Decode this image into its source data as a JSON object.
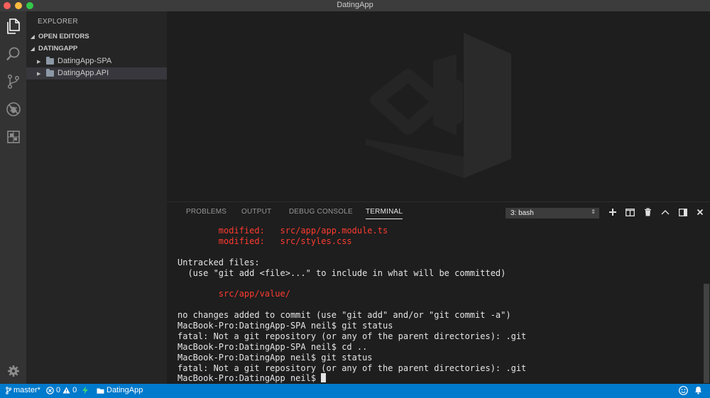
{
  "window": {
    "title": "DatingApp"
  },
  "sidebar": {
    "title": "EXPLORER",
    "sections": [
      {
        "label": "OPEN EDITORS"
      },
      {
        "label": "DATINGAPP"
      }
    ],
    "items": [
      {
        "label": "DatingApp-SPA"
      },
      {
        "label": "DatingApp.API"
      }
    ]
  },
  "panel": {
    "tabs": [
      {
        "label": "PROBLEMS"
      },
      {
        "label": "OUTPUT"
      },
      {
        "label": "DEBUG CONSOLE"
      },
      {
        "label": "TERMINAL"
      }
    ],
    "active_tab": "TERMINAL",
    "terminal_select": "3: bash"
  },
  "terminal": {
    "lines": [
      {
        "text": "        modified:   src/app/app.module.ts",
        "color": "red"
      },
      {
        "text": "        modified:   src/styles.css",
        "color": "red"
      },
      {
        "text": "",
        "color": "default"
      },
      {
        "text": "Untracked files:",
        "color": "default"
      },
      {
        "text": "  (use \"git add <file>...\" to include in what will be committed)",
        "color": "default"
      },
      {
        "text": "",
        "color": "default"
      },
      {
        "text": "        src/app/value/",
        "color": "red"
      },
      {
        "text": "",
        "color": "default"
      },
      {
        "text": "no changes added to commit (use \"git add\" and/or \"git commit -a\")",
        "color": "default"
      },
      {
        "text": "MacBook-Pro:DatingApp-SPA neil$ git status",
        "color": "default"
      },
      {
        "text": "fatal: Not a git repository (or any of the parent directories): .git",
        "color": "default"
      },
      {
        "text": "MacBook-Pro:DatingApp-SPA neil$ cd ..",
        "color": "default"
      },
      {
        "text": "MacBook-Pro:DatingApp neil$ git status",
        "color": "default"
      },
      {
        "text": "fatal: Not a git repository (or any of the parent directories): .git",
        "color": "default"
      }
    ],
    "prompt": "MacBook-Pro:DatingApp neil$ "
  },
  "statusbar": {
    "branch": "master*",
    "errors": "0",
    "warnings": "0",
    "folder": "DatingApp"
  },
  "colors": {
    "accent": "#007acc",
    "terminal_red": "#ff3b30"
  },
  "icons": {
    "activity": [
      "files-icon",
      "search-icon",
      "source-control-icon",
      "debug-icon",
      "extensions-icon",
      "settings-gear-icon"
    ],
    "panel_actions": [
      "add-terminal-icon",
      "split-terminal-icon",
      "trash-icon",
      "maximize-panel-icon",
      "toggle-panel-position-icon",
      "close-panel-icon"
    ]
  }
}
